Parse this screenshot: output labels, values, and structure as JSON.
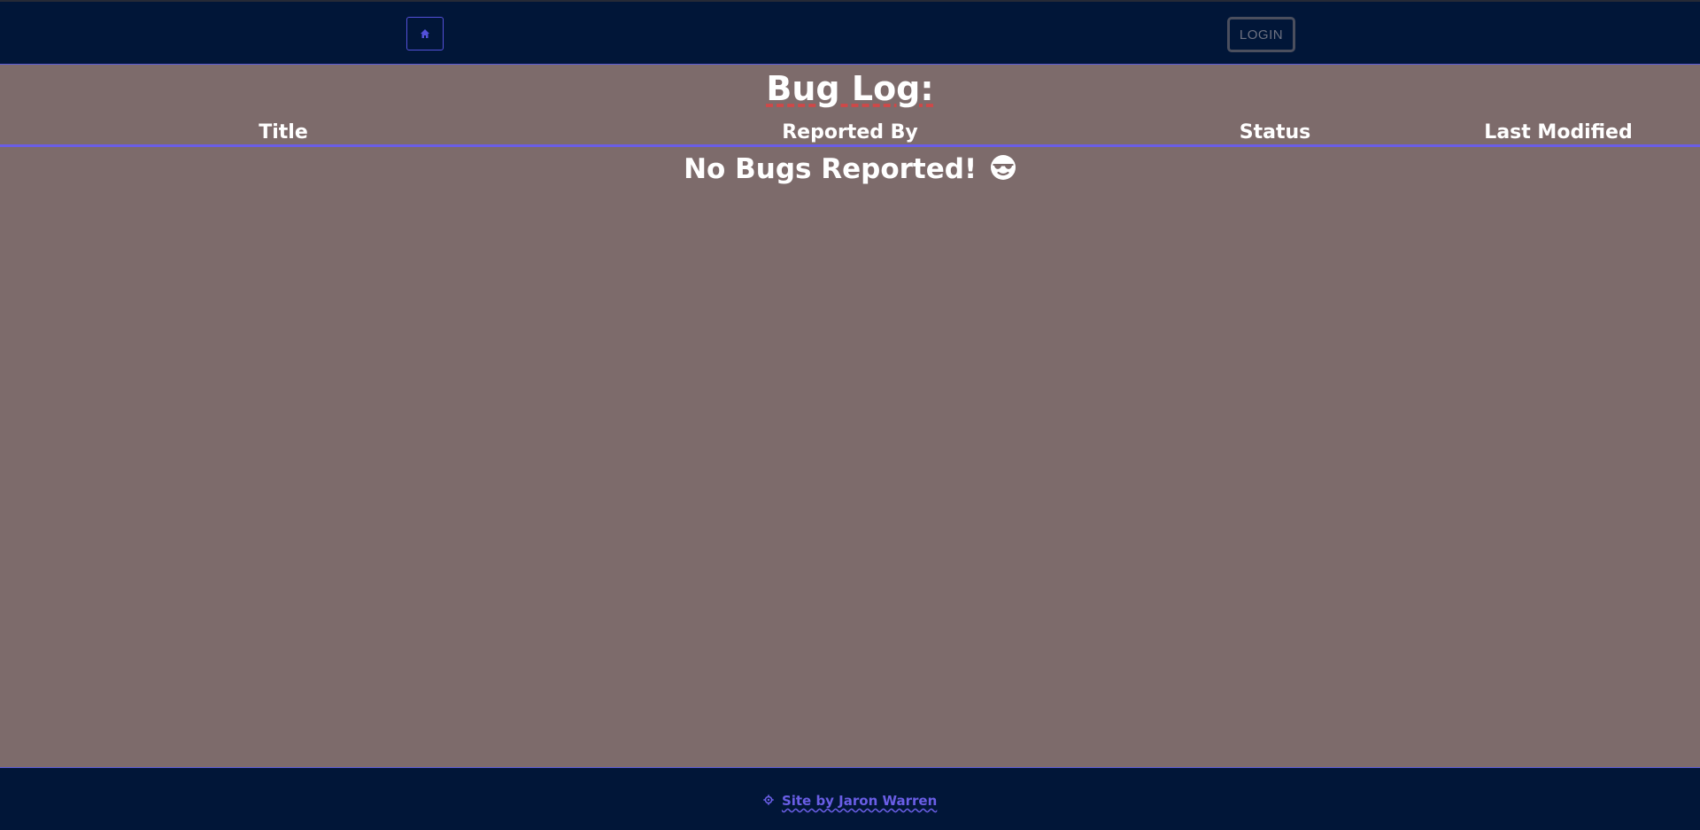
{
  "navbar": {
    "home_icon": "home-icon",
    "login_label": "LOGIN"
  },
  "main": {
    "title": "Bug Log:",
    "columns": [
      "Title",
      "Reported By",
      "Status",
      "Last Modified"
    ],
    "empty_message": "No Bugs Reported!",
    "empty_icon": "sunglasses-face-icon"
  },
  "footer": {
    "icon": "gear-icon",
    "credit": "Site by Jaron Warren"
  },
  "colors": {
    "navbar_bg": "#011638",
    "page_bg": "#7d6b6b",
    "accent": "#6a5ee6",
    "text": "#ffffff"
  }
}
